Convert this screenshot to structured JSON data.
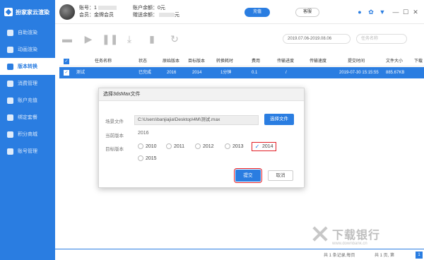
{
  "app": {
    "brand": "扮家家云渲染"
  },
  "sidebar": {
    "items": [
      {
        "label": "自助渲染",
        "icon": "render-icon"
      },
      {
        "label": "动画渲染",
        "icon": "animation-icon"
      },
      {
        "label": "版本转换",
        "icon": "convert-icon",
        "active": true
      },
      {
        "label": "消费管理",
        "icon": "wallet-icon"
      },
      {
        "label": "账户充值",
        "icon": "recharge-icon"
      },
      {
        "label": "绑定套餐",
        "icon": "package-icon"
      },
      {
        "label": "积分商城",
        "icon": "mall-icon"
      },
      {
        "label": "账号管理",
        "icon": "user-icon"
      }
    ]
  },
  "header": {
    "account_label": "账号：",
    "account_value": "1",
    "member_label": "会员：",
    "member_value": "金牌会员",
    "balance_label": "账户余额：",
    "balance_value": "0元",
    "gift_label": "赠送余额：",
    "gift_value": "元",
    "recharge_button": "充值",
    "service_button": "客服",
    "icons": [
      "chat-icon",
      "settings-icon",
      "dropdown-icon"
    ]
  },
  "toolbar": {
    "icons": [
      "folder-icon",
      "play-icon",
      "pause-icon",
      "download-icon",
      "delete-icon",
      "refresh-icon"
    ],
    "date_range": "2019.07.06-2019.08.06",
    "search_placeholder": "任务名称"
  },
  "table": {
    "columns": [
      "任务名称",
      "状态",
      "原始版本",
      "目标版本",
      "转换耗时",
      "费用",
      "传输进度",
      "传输速度",
      "提交时间",
      "文件大小",
      "下载"
    ],
    "rows": [
      {
        "name": "测试",
        "status": "已完成",
        "original": "2016",
        "target": "2014",
        "duration": "1分钟",
        "cost": "0.1",
        "progress": "/",
        "speed": "",
        "submitted": "2019-07-30 15:15:55",
        "size": "885.67KB"
      }
    ]
  },
  "dialog": {
    "title": "选择3dsMax文件",
    "scene_label": "场景文件",
    "scene_path": "C:\\Users\\banjiajia\\Desktop\\4M\\测试.max",
    "choose_button": "选择文件",
    "current_label": "当前版本",
    "current_value": "2016",
    "target_label": "目标版本",
    "versions": [
      "2010",
      "2011",
      "2012",
      "2013",
      "2014",
      "2015"
    ],
    "selected_version": "2014",
    "submit_button": "提交",
    "cancel_button": "取消"
  },
  "footer": {
    "summary": "共 1 条记录,每页",
    "pages": "共 1 页, 第",
    "page_number": "1"
  },
  "watermark": {
    "text": "下载银行",
    "sub": "www.downbank.cn"
  }
}
